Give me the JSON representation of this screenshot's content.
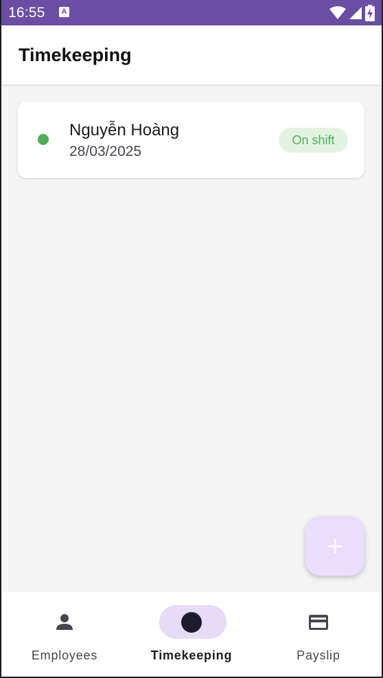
{
  "status_bar": {
    "time": "16:55",
    "notification_icon": "A",
    "icons": [
      "wifi-icon",
      "signal-icon",
      "battery-charging-icon"
    ]
  },
  "app_bar": {
    "title": "Timekeeping"
  },
  "records": [
    {
      "name": "Nguyễn Hoàng",
      "date": "28/03/2025",
      "status": "On shift",
      "status_color": "#4caf50"
    }
  ],
  "fab": {
    "icon": "plus-icon",
    "label": "+"
  },
  "bottom_nav": {
    "items": [
      {
        "label": "Employees",
        "icon": "person-icon",
        "active": false
      },
      {
        "label": "Timekeeping",
        "icon": "circle-icon",
        "active": true
      },
      {
        "label": "Payslip",
        "icon": "card-icon",
        "active": false
      }
    ]
  },
  "colors": {
    "status_bar": "#6a4ea3",
    "background": "#f4f4f4",
    "accent_container": "#eaddfd",
    "nav_indicator": "#e6dcf7",
    "on_shift_green": "#4caf50"
  }
}
